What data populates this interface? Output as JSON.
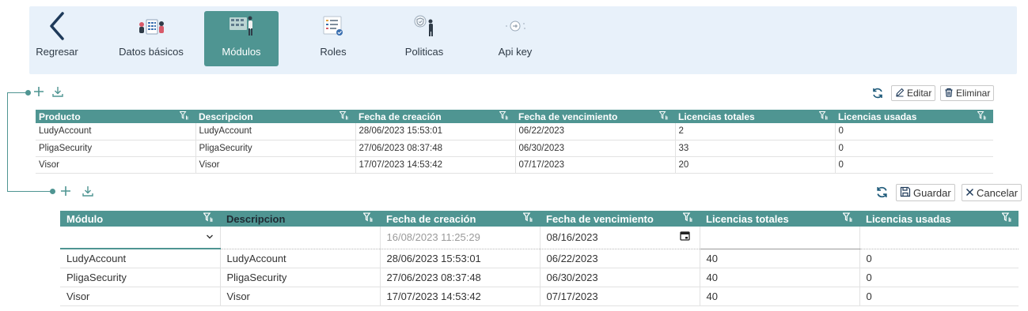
{
  "nav": {
    "back_label": "Regresar",
    "items": [
      {
        "label": "Datos básicos"
      },
      {
        "label": "Módulos"
      },
      {
        "label": "Roles"
      },
      {
        "label": "Politicas"
      },
      {
        "label": "Api key"
      }
    ]
  },
  "toolbar_top": {
    "edit_label": "Editar",
    "delete_label": "Eliminar"
  },
  "table_top": {
    "columns": [
      "Producto",
      "Descripcion",
      "Fecha de creación",
      "Fecha de vencimiento",
      "Licencias totales",
      "Licencias usadas"
    ],
    "rows": [
      [
        "LudyAccount",
        "LudyAccount",
        "28/06/2023 15:53:01",
        "06/22/2023",
        "2",
        "0"
      ],
      [
        "PligaSecurity",
        "PligaSecurity",
        "27/06/2023 08:37:48",
        "06/30/2023",
        "33",
        "0"
      ],
      [
        "Visor",
        "Visor",
        "17/07/2023 14:53:42",
        "07/17/2023",
        "20",
        "0"
      ]
    ]
  },
  "toolbar_bottom": {
    "save_label": "Guardar",
    "cancel_label": "Cancelar"
  },
  "table_bottom": {
    "columns": [
      "Módulo",
      "Descripcion",
      "Fecha de creación",
      "Fecha de vencimiento",
      "Licencias totales",
      "Licencias usadas"
    ],
    "edit_row": {
      "created_placeholder": "16/08/2023 11:25:29",
      "expiry_value": "08/16/2023"
    },
    "rows": [
      [
        "LudyAccount",
        "LudyAccount",
        "28/06/2023 15:53:01",
        "06/22/2023",
        "40",
        "0"
      ],
      [
        "PligaSecurity",
        "PligaSecurity",
        "27/06/2023 08:37:48",
        "06/30/2023",
        "40",
        "0"
      ],
      [
        "Visor",
        "Visor",
        "17/07/2023 14:53:42",
        "07/17/2023",
        "40",
        "0"
      ]
    ]
  },
  "colors": {
    "accent": "#4f9592",
    "nav_bg": "#e8f1fa"
  }
}
